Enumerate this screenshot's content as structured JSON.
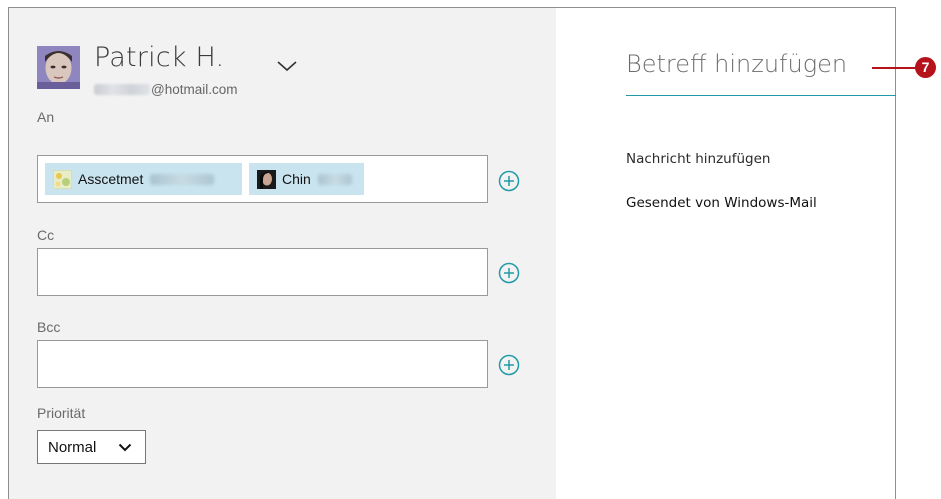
{
  "account": {
    "name": "Patrick H.",
    "email_domain": "@hotmail.com",
    "chevron_icon": "chevron-down-icon"
  },
  "to": {
    "label": "An",
    "recipients": [
      {
        "name": "Asscetmet",
        "avatar_icon": "contact-photo-icon"
      },
      {
        "name": "Chin",
        "avatar_icon": "contact-photo-icon"
      }
    ],
    "add_icon": "add-circle-icon"
  },
  "cc": {
    "label": "Cc",
    "value": "",
    "add_icon": "add-circle-icon"
  },
  "bcc": {
    "label": "Bcc",
    "value": "",
    "add_icon": "add-circle-icon"
  },
  "priority": {
    "label": "Priorität",
    "selected": "Normal"
  },
  "compose": {
    "subject_placeholder": "Betreff hinzufügen",
    "body_placeholder": "Nachricht hinzufügen",
    "signature": "Gesendet von Windows-Mail"
  },
  "callout": {
    "number": "7"
  },
  "colors": {
    "accent": "#1f9aa6",
    "chip": "#c9e4ef",
    "callout": "#b5121b",
    "pane_left": "#f2f2f2"
  }
}
